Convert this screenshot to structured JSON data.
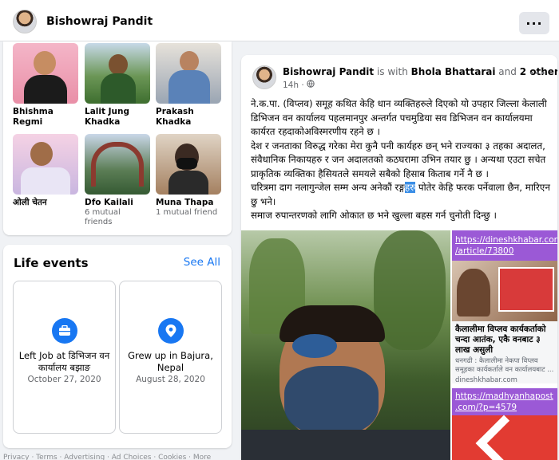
{
  "header": {
    "profile_name": "Bishowraj Pandit",
    "more_label": "···"
  },
  "friends": [
    {
      "name": "Bhishma Regmi",
      "mutual": ""
    },
    {
      "name": "Lalit Jung Khadka",
      "mutual": ""
    },
    {
      "name": "Prakash Khadka",
      "mutual": ""
    },
    {
      "name": "ओली चेतन",
      "mutual": ""
    },
    {
      "name": "Dfo Kailali",
      "mutual": "6 mutual friends"
    },
    {
      "name": "Muna Thapa",
      "mutual": "1 mutual friend"
    }
  ],
  "life_events": {
    "title": "Life events",
    "see_all": "See All",
    "items": [
      {
        "title": "Left Job at डिभिजन वन कार्यालय बझाङ",
        "date": "October 27, 2020",
        "icon": "briefcase-icon"
      },
      {
        "title": "Grew up in Bajura, Nepal",
        "date": "August 28, 2020",
        "icon": "location-pin-icon"
      }
    ]
  },
  "footer_text": "Privacy · Terms · Advertising · Ad Choices · Cookies · More",
  "post": {
    "author": "Bishowraj Pandit",
    "with_text": "is with",
    "tagged": "Bhola Bhattarai",
    "and_text": "and",
    "others": "2 others.",
    "time": "14h ·",
    "body_lines": [
      "ने.क.पा. (विप्लव) समूह कथित केहि धान व्यक्तिहरुले दिएको  यो उपहार जिल्ला केलाली डिभिजन वन कार्यालय पहलमानपुर अन्तर्गत पचमुडिया सव डिभिजन वन कार्यालयमा कार्यरत रहदाकोअविस्मरणीय रहने छ ।",
      "देश र जनताका विरुद्ध गरेका मेरा कुनै पनी कार्यहरु छन् भने राज्यका ३ तहका अदालत, संवैधानिक निकायहरु र जन अदालतको कठघरामा उभिन तयार छु । अन्यथा एउटा सचेत प्राकृतिक व्यक्तिका हैसियतले समयले सबैको हिसाब किताब गर्ने नै छ ।",
      "चरित्रमा दाग नलागुन्जेल सम्म अन्य अनेकौं रङ्ग|हरु| पोतेर केहि फरक पर्नेवाला छैन, मारिएन छु भने।",
      "समाज रुपान्तरणको लागि ओकात छ भने खुल्ला बहस गर्न चुनोती दिन्छु ।"
    ],
    "link1": {
      "url": "https://dineshkhabar.com /article/73800",
      "title": "कैलालीमा विप्लव कार्यकर्ताको चन्दा आतंक, एकै वनबाट ३ लाख असुली",
      "desc": "धनगढी : कैलालीमा नेकपा विप्लव समूहका कार्यकर्ताले वन कार्यालयबाट ...",
      "domain": "dineshkhabar.com"
    },
    "link2": {
      "url": "https://madhyanhapost .com/?p=4579"
    }
  },
  "colors": {
    "accent": "#1877f2",
    "link_bar": "#9b59d6",
    "highlight": "#3a8ee6"
  }
}
